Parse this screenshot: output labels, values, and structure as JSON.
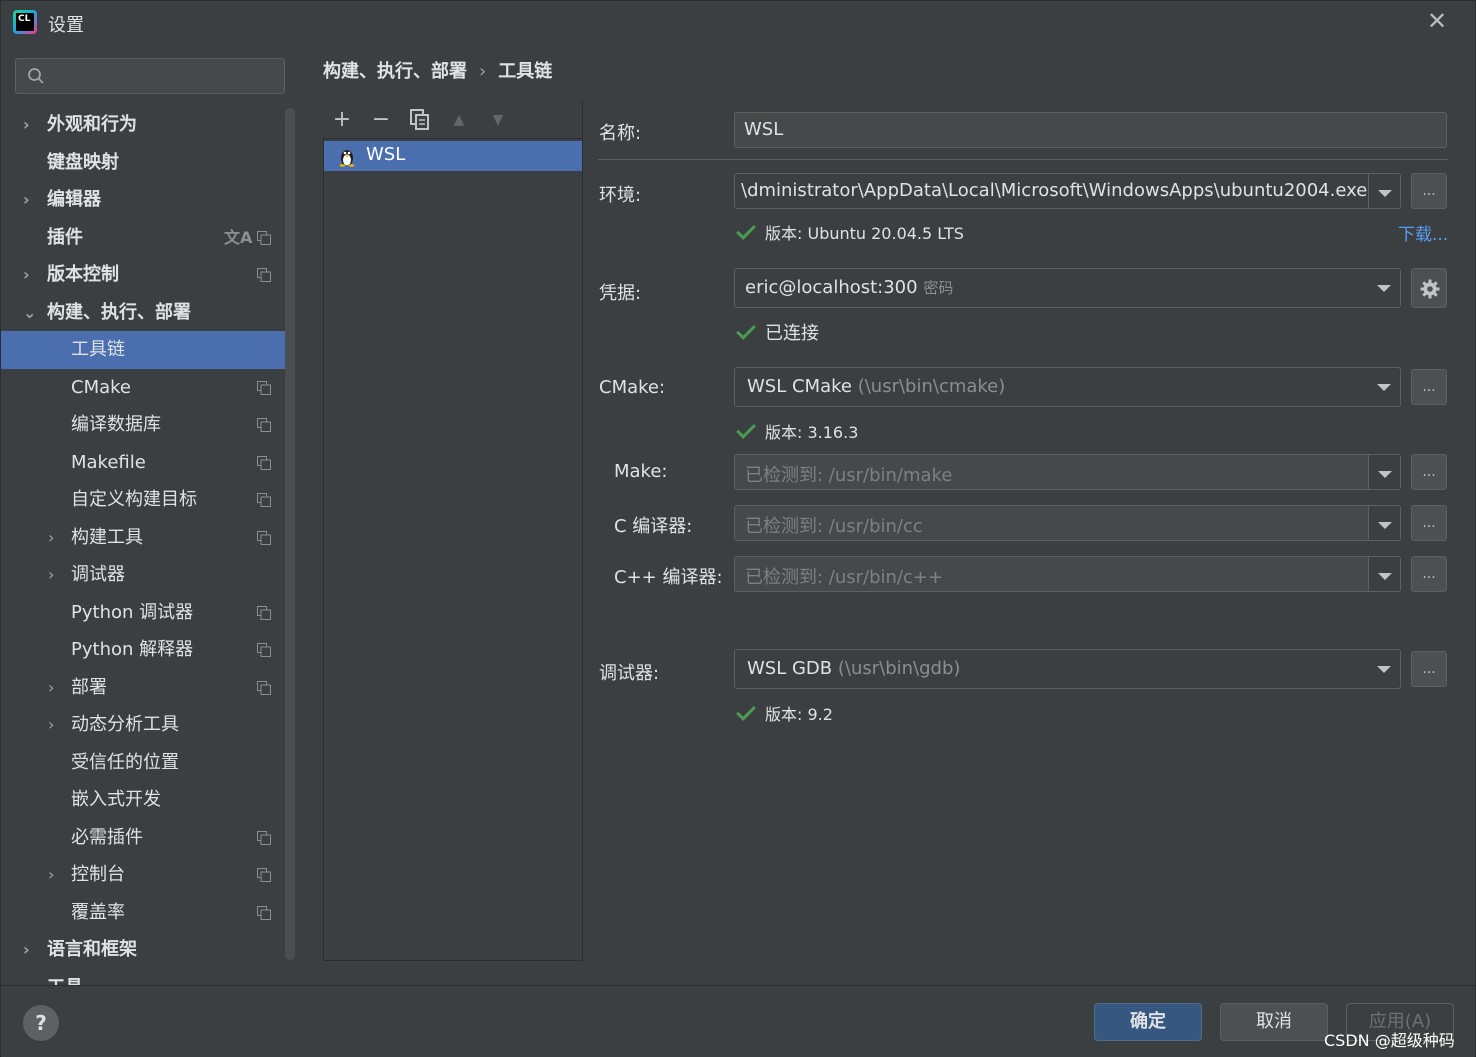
{
  "window": {
    "title": "设置",
    "close_glyph": "✕"
  },
  "search": {
    "placeholder": ""
  },
  "sidebar": {
    "items": [
      {
        "label": "外观和行为",
        "chevron": "›"
      },
      {
        "label": "键盘映射"
      },
      {
        "label": "编辑器",
        "chevron": "›"
      },
      {
        "label": "插件"
      },
      {
        "label": "版本控制",
        "chevron": "›"
      },
      {
        "label": "构建、执行、部署",
        "chevron": "⌄"
      },
      {
        "label": "工具链"
      },
      {
        "label": "CMake"
      },
      {
        "label": "编译数据库"
      },
      {
        "label": "Makefile"
      },
      {
        "label": "自定义构建目标"
      },
      {
        "label": "构建工具",
        "chevron": "›"
      },
      {
        "label": "调试器",
        "chevron": "›"
      },
      {
        "label": "Python 调试器"
      },
      {
        "label": "Python 解释器"
      },
      {
        "label": "部署",
        "chevron": "›"
      },
      {
        "label": "动态分析工具",
        "chevron": "›"
      },
      {
        "label": "受信任的位置"
      },
      {
        "label": "嵌入式开发"
      },
      {
        "label": "必需插件"
      },
      {
        "label": "控制台",
        "chevron": "›"
      },
      {
        "label": "覆盖率"
      },
      {
        "label": "语言和框架",
        "chevron": "›"
      },
      {
        "label": "工具",
        "chevron": "›"
      }
    ],
    "translate_glyph": "文A"
  },
  "breadcrumb": {
    "parent": "构建、执行、部署",
    "separator": "›",
    "current": "工具链"
  },
  "toolbar": {
    "add": "+",
    "remove": "−",
    "up": "▲",
    "down": "▼"
  },
  "toolchains": [
    {
      "name": "WSL"
    }
  ],
  "form": {
    "name_label": "名称:",
    "name_value": "WSL",
    "env_label": "环境:",
    "env_value": "\\dministrator\\AppData\\Local\\Microsoft\\WindowsApps\\ubuntu2004.exe",
    "env_status": "版本: Ubuntu 20.04.5 LTS",
    "download_link": "下载...",
    "cred_label": "凭据:",
    "cred_value": "eric@localhost:300",
    "cred_hint": "密码",
    "cred_status": "已连接",
    "cmake_label": "CMake:",
    "cmake_value": "WSL CMake",
    "cmake_hint": "(\\usr\\bin\\cmake)",
    "cmake_status": "版本: 3.16.3",
    "make_label": "Make:",
    "make_value": "已检测到: /usr/bin/make",
    "c_label": "C 编译器:",
    "c_value": "已检测到: /usr/bin/cc",
    "cpp_label": "C++ 编译器:",
    "cpp_value": "已检测到: /usr/bin/c++",
    "debugger_label": "调试器:",
    "debugger_value": "WSL GDB",
    "debugger_hint": "(\\usr\\bin\\gdb)",
    "debugger_status": "版本: 9.2",
    "dots": "..."
  },
  "buttons": {
    "help": "?",
    "ok": "确定",
    "cancel": "取消",
    "apply": "应用(A)"
  },
  "watermark": "CSDN @超级种码",
  "colors": {
    "selection": "#4b6eaf",
    "success": "#499c54",
    "link": "#589df6",
    "primary_button": "#365880"
  }
}
